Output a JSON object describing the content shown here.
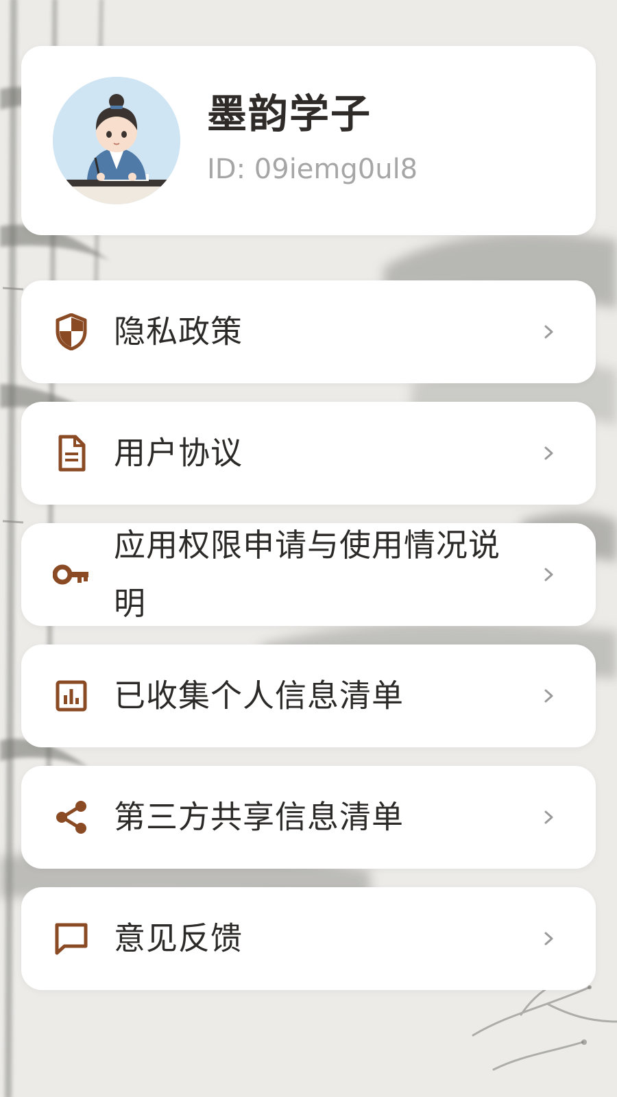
{
  "profile": {
    "name": "墨韵学子",
    "id_text": "ID: 09iemg0ul8"
  },
  "menu": {
    "items": [
      {
        "label": "隐私政策",
        "icon": "shield-icon"
      },
      {
        "label": "用户协议",
        "icon": "document-icon"
      },
      {
        "label": "应用权限申请与使用情况说明",
        "icon": "key-icon"
      },
      {
        "label": "已收集个人信息清单",
        "icon": "bar-chart-icon"
      },
      {
        "label": "第三方共享信息清单",
        "icon": "share-icon"
      },
      {
        "label": "意见反馈",
        "icon": "message-icon"
      }
    ]
  },
  "colors": {
    "accent": "#8a4a24",
    "card_background": "#ffffff",
    "text_primary": "#2c2a28",
    "text_secondary": "#a6a6a6",
    "chevron": "#9a9a9a"
  }
}
